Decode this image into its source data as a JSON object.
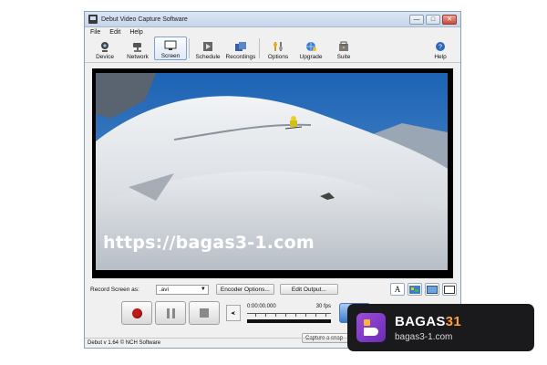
{
  "window": {
    "title": "Debut Video Capture Software",
    "controls": {
      "minimize": "—",
      "maximize": "□",
      "close": "✕"
    }
  },
  "menu": [
    "File",
    "Edit",
    "Help"
  ],
  "toolbar": {
    "items": [
      {
        "label": "Device",
        "icon": "webcam-icon"
      },
      {
        "label": "Network",
        "icon": "network-camera-icon"
      },
      {
        "label": "Screen",
        "icon": "monitor-icon",
        "active": true
      },
      {
        "label": "Schedule",
        "icon": "schedule-icon"
      },
      {
        "label": "Recordings",
        "icon": "recordings-icon"
      },
      {
        "label": "Options",
        "icon": "options-icon"
      },
      {
        "label": "Upgrade",
        "icon": "upgrade-globe-icon"
      },
      {
        "label": "Suite",
        "icon": "suite-icon"
      }
    ],
    "help_label": "Help"
  },
  "preview": {
    "watermark": "https://bagas3-1.com"
  },
  "record_bar": {
    "record_label": "Record Screen as:",
    "format_value": ".avi",
    "encoder_button": "Encoder Options...",
    "edit_output_button": "Edit Output...",
    "text_overlay_glyph": "A"
  },
  "playback": {
    "time": "0:00:00.000",
    "fps": "30 fps",
    "volume_glyph": "◂:"
  },
  "snapshot_button": "Capture a snap-",
  "status": "Debut v 1.64 © NCH Software",
  "badge": {
    "name_a": "BAGAS",
    "name_b": "31",
    "url": "bagas3-1.com"
  },
  "colors": {
    "record": "#c01a1a",
    "accent": "#3b7ccc",
    "badge_bg": "#1a1a1d",
    "badge_highlight": "#ff9f3a",
    "logo_purple": "#8a3fd0"
  }
}
